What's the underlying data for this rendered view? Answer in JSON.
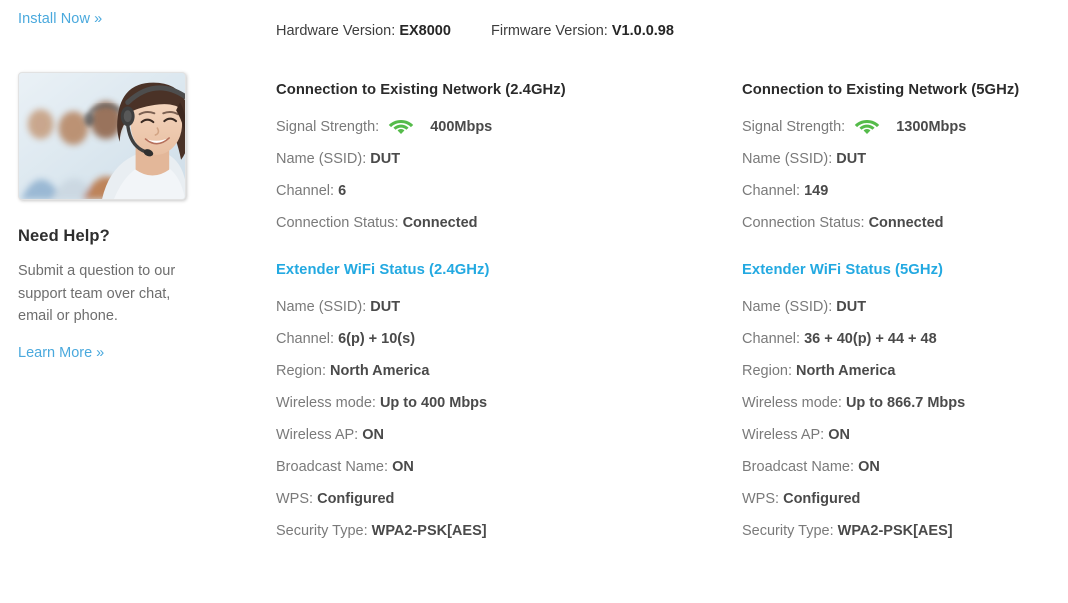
{
  "top": {
    "install_link": "Install Now »"
  },
  "version": {
    "hardware_label": "Hardware Version:",
    "hardware_value": "EX8000",
    "firmware_label": "Firmware Version:",
    "firmware_value": "V1.0.0.98"
  },
  "sidebar": {
    "photo_alt": "support-agent-headset-photo",
    "title": "Need Help?",
    "text": "Submit a question to our support team over chat, email or phone.",
    "learn_more": "Learn More »"
  },
  "colors": {
    "link_blue": "#4aa9dd",
    "accent_blue": "#23a9e1",
    "signal_green": "#55bb4a",
    "label_gray": "#7a7a7a",
    "value_gray": "#4a4a4a"
  },
  "columns": [
    {
      "id": "band-2-4ghz",
      "connection": {
        "title": "Connection to Existing Network (2.4GHz)",
        "signal_label": "Signal Strength:",
        "signal_icon": "wifi-signal-icon",
        "signal_value": "400Mbps",
        "rows": [
          {
            "label": "Name (SSID):",
            "value": "DUT"
          },
          {
            "label": "Channel:",
            "value": "6"
          },
          {
            "label": "Connection Status:",
            "value": "Connected"
          }
        ]
      },
      "extender": {
        "title": "Extender WiFi Status (2.4GHz)",
        "rows": [
          {
            "label": "Name (SSID):",
            "value": "DUT"
          },
          {
            "label": "Channel:",
            "value": "6(p) + 10(s)"
          },
          {
            "label": "Region:",
            "value": "North America"
          },
          {
            "label": "Wireless mode:",
            "value": "Up to 400 Mbps"
          },
          {
            "label": "Wireless AP:",
            "value": "ON"
          },
          {
            "label": "Broadcast Name:",
            "value": "ON"
          },
          {
            "label": "WPS:",
            "value": "Configured"
          },
          {
            "label": "Security Type:",
            "value": "WPA2-PSK[AES]"
          }
        ]
      }
    },
    {
      "id": "band-5ghz",
      "connection": {
        "title": "Connection to Existing Network (5GHz)",
        "signal_label": "Signal Strength:",
        "signal_icon": "wifi-signal-icon",
        "signal_value": "1300Mbps",
        "rows": [
          {
            "label": "Name (SSID):",
            "value": "DUT"
          },
          {
            "label": "Channel:",
            "value": "149"
          },
          {
            "label": "Connection Status:",
            "value": "Connected"
          }
        ]
      },
      "extender": {
        "title": "Extender WiFi Status (5GHz)",
        "rows": [
          {
            "label": "Name (SSID):",
            "value": "DUT"
          },
          {
            "label": "Channel:",
            "value": "36 + 40(p) + 44 + 48"
          },
          {
            "label": "Region:",
            "value": "North America"
          },
          {
            "label": "Wireless mode:",
            "value": "Up to 866.7 Mbps"
          },
          {
            "label": "Wireless AP:",
            "value": "ON"
          },
          {
            "label": "Broadcast Name:",
            "value": "ON"
          },
          {
            "label": "WPS:",
            "value": "Configured"
          },
          {
            "label": "Security Type:",
            "value": "WPA2-PSK[AES]"
          }
        ]
      }
    }
  ]
}
